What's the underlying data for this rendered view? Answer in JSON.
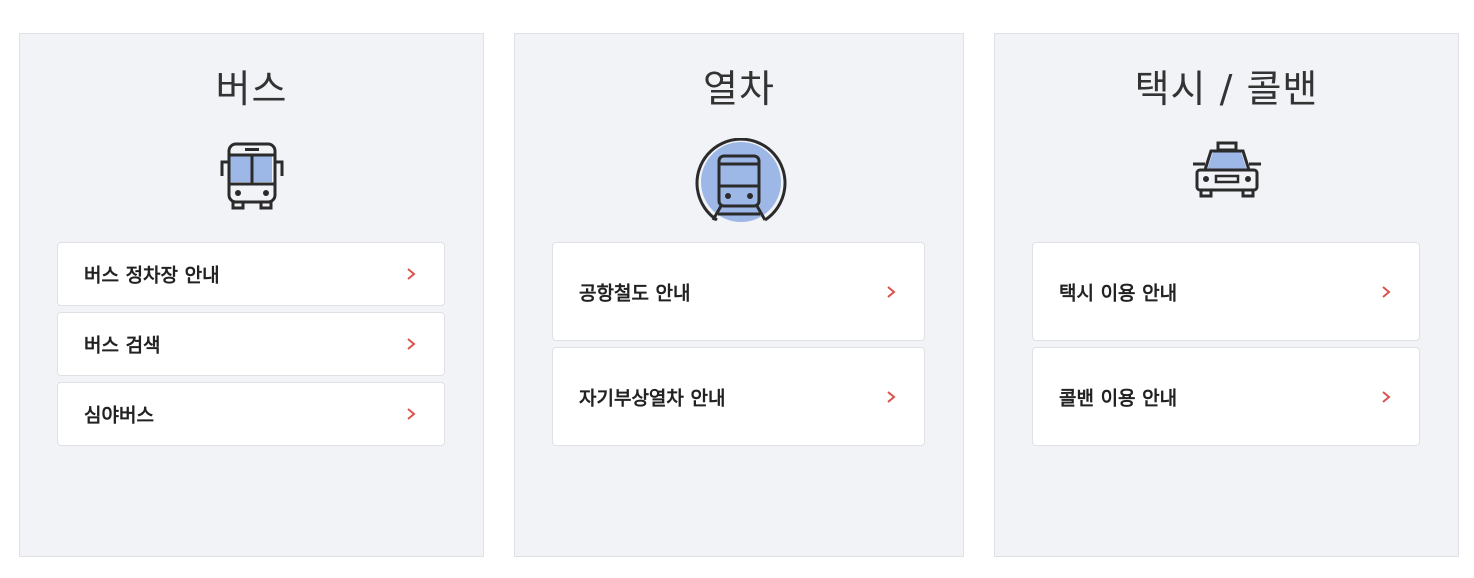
{
  "colors": {
    "panel_bg": "#f2f3f7",
    "item_bg": "#ffffff",
    "chevron": "#d9534f",
    "icon_accent": "#9db7e6",
    "icon_stroke": "#2b2b2b"
  },
  "panels": [
    {
      "title": "버스",
      "icon": "bus-icon",
      "items": [
        {
          "label": "버스 정차장 안내"
        },
        {
          "label": "버스 검색"
        },
        {
          "label": "심야버스"
        }
      ]
    },
    {
      "title": "열차",
      "icon": "train-icon",
      "items": [
        {
          "label": "공항철도 안내"
        },
        {
          "label": "자기부상열차 안내"
        }
      ]
    },
    {
      "title": "택시 / 콜밴",
      "icon": "taxi-icon",
      "items": [
        {
          "label": "택시 이용 안내"
        },
        {
          "label": "콜밴 이용 안내"
        }
      ]
    }
  ]
}
